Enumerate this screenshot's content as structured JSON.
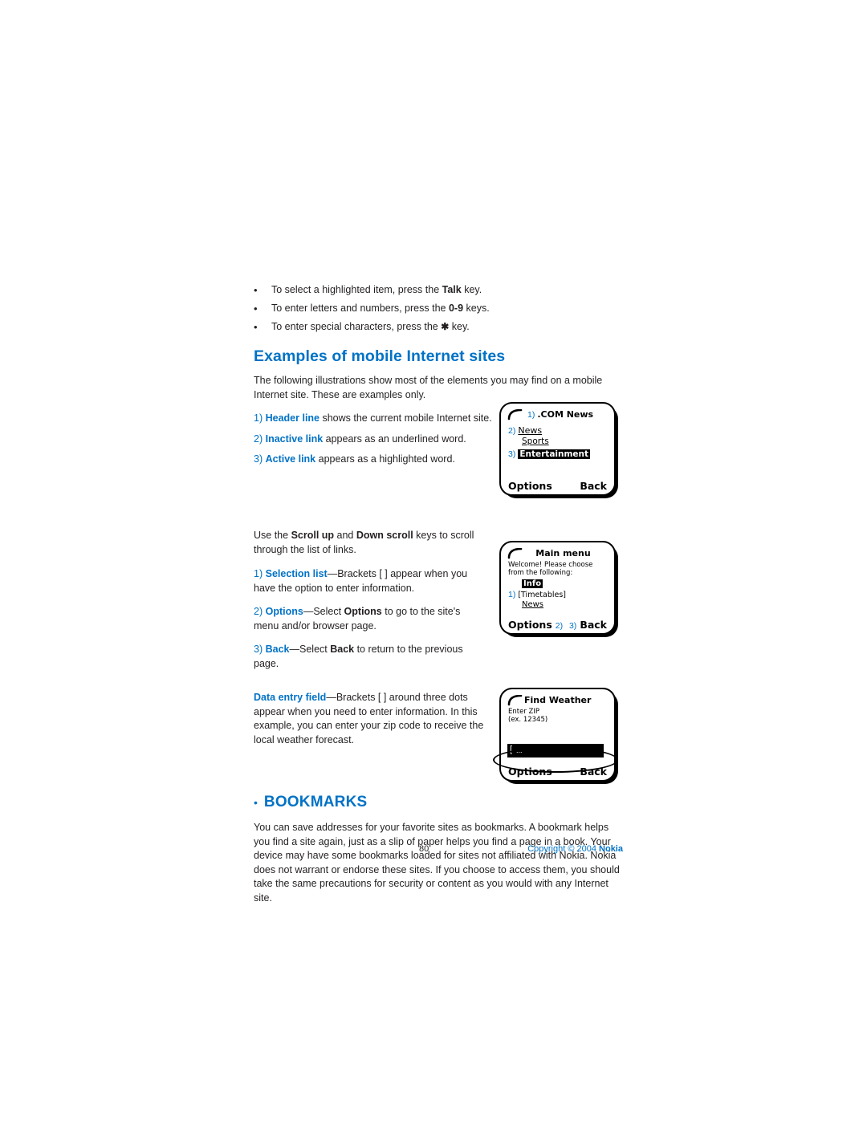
{
  "bullets": [
    {
      "pre": "To select a highlighted item, press the ",
      "bold": "Talk",
      "post": " key."
    },
    {
      "pre": "To enter letters and numbers, press the ",
      "bold": "0-9",
      "post": " keys."
    },
    {
      "pre": "To enter special characters, press the ",
      "bold": "✱",
      "post": " key."
    }
  ],
  "section": {
    "title": "Examples of mobile Internet sites",
    "intro": "The following illustrations show most of the elements you may find on a mobile Internet site. These are examples only."
  },
  "legend1": [
    {
      "num": "1)",
      "term": "Header line",
      "rest": " shows the current mobile Internet site."
    },
    {
      "num": "2)",
      "term": "Inactive link",
      "rest": " appears as an underlined word."
    },
    {
      "num": "3)",
      "term": "Active link",
      "rest": " appears as a highlighted word."
    }
  ],
  "scroll_note": {
    "pre": "Use the ",
    "b1": "Scroll up",
    "mid": " and ",
    "b2": "Down scroll",
    "post": " keys to scroll through the list of links."
  },
  "legend2": [
    {
      "num": "1)",
      "term": "Selection list",
      "rest": "—Brackets [ ] appear when you have the option to enter information."
    },
    {
      "num": "2)",
      "term": "Options",
      "rest1": "—Select ",
      "bold": "Options",
      "rest2": " to go to the site's menu and/or browser page."
    },
    {
      "num": "3)",
      "term": "Back",
      "rest1": "—Select ",
      "bold": "Back",
      "rest2": " to return to the previous page."
    }
  ],
  "data_entry": {
    "term": "Data entry field",
    "rest1": "—Brackets [ ] around three dots appear when you need to enter information. In this example, you can enter your zip code to receive the local weather forecast."
  },
  "bookmarks": {
    "title": "BOOKMARKS",
    "body": "You can save addresses for your favorite sites as bookmarks. A bookmark helps you find a site again, just as a slip of paper helps you find a page in a book. Your device may have some bookmarks loaded for sites not affiliated with Nokia. Nokia does not warrant or endorse these sites. If you choose to access them, you should take the same precautions for security or content as you would with any Internet site."
  },
  "phone1": {
    "header": ".COM News",
    "num_header": "1)",
    "num_news": "2)",
    "item_news": "News",
    "item_sports": "Sports",
    "num_ent": "3)",
    "item_entertainment": "Entertainment",
    "left_key": "Options",
    "right_key": "Back"
  },
  "phone2": {
    "header": "Main menu",
    "line1": "Welcome! Please choose",
    "line2": "from the following:",
    "item_info": "Info",
    "num_sel": "1)",
    "item_timetables": "[Timetables]",
    "item_news": "News",
    "left_key": "Options",
    "left_num": "2)",
    "right_num": "3)",
    "right_key": "Back"
  },
  "phone3": {
    "header": "Find Weather",
    "line1": "Enter ZIP",
    "line2": "(ex. 12345)",
    "field_bracket": "[",
    "field_dots": "...",
    "left_key": "Options",
    "right_key": "Back"
  },
  "footer": {
    "page": "80",
    "copyright_pre": "Copyright © 2004 ",
    "copyright_brand": "Nokia"
  },
  "colors": {
    "accent": "#0072c6",
    "text": "#231f20"
  }
}
